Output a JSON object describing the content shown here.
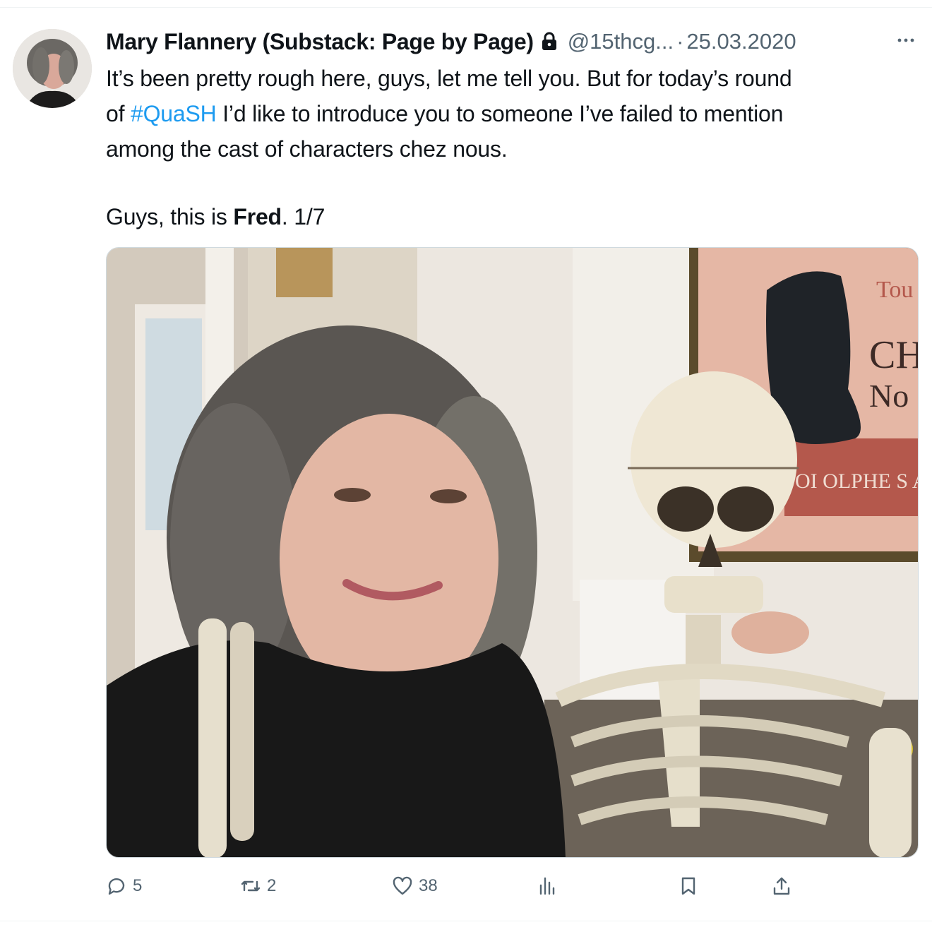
{
  "tweet": {
    "author_name": "Mary Flannery (Substack: Page by Page)",
    "handle": "@15thcg...",
    "separator": "·",
    "date": "25.03.2020",
    "text_line1": "It’s been pretty rough here, guys, let me tell you. But for today’s round",
    "text_line2_prefix": "of ",
    "hashtag": "#QuaSH",
    "text_line2_suffix": " I’d like to introduce you to someone I’ve failed to mention",
    "text_line3": "among the cast of characters chez nous.",
    "para2_prefix": "Guys, this is ",
    "para2_bold": "Fred",
    "para2_suffix": ". 1/7"
  },
  "media": {
    "poster_text_1": "Tou",
    "poster_text_2": "CH",
    "poster_text_3": "No",
    "poster_text_4": "OI   OLPHE S  A"
  },
  "actions": {
    "replies": "5",
    "retweets": "2",
    "likes": "38",
    "views": ""
  },
  "icons": {
    "lock": "lock-icon",
    "more": "more-icon",
    "reply": "reply-icon",
    "retweet": "retweet-icon",
    "like": "heart-icon",
    "views": "views-icon",
    "bookmark": "bookmark-icon",
    "share": "share-icon"
  },
  "colors": {
    "text": "#0f1419",
    "secondary": "#536471",
    "link": "#1d9bf0"
  }
}
